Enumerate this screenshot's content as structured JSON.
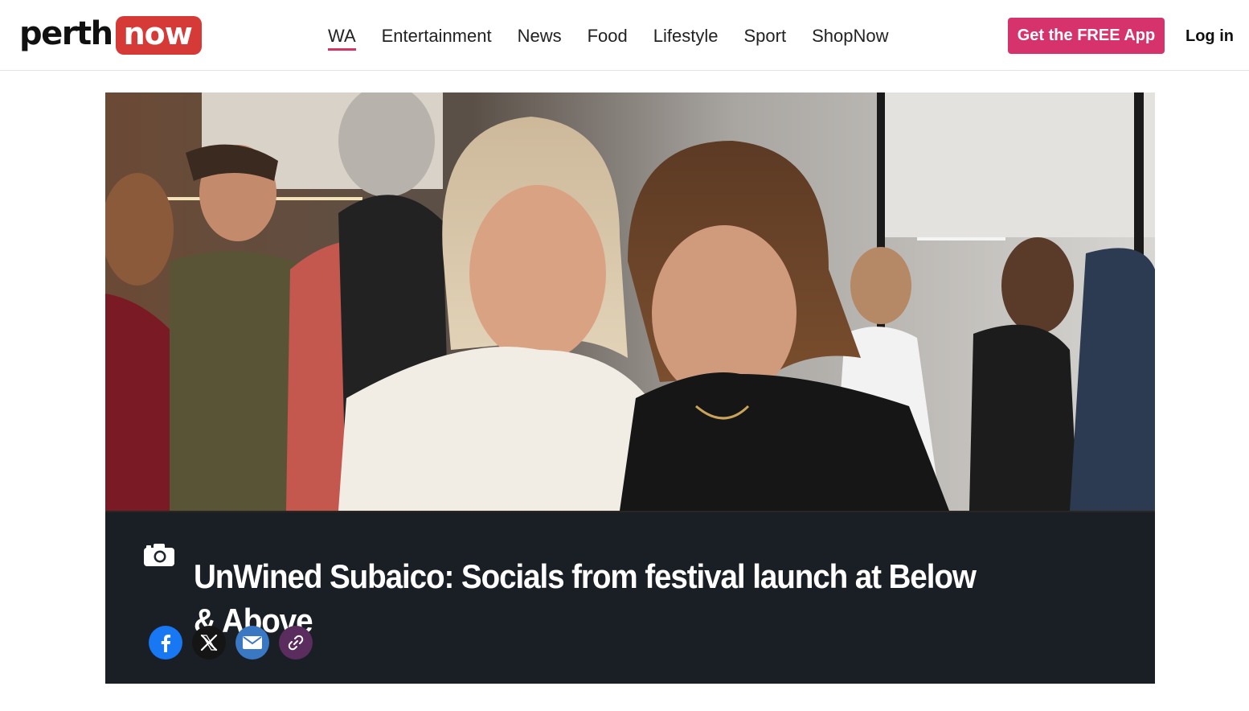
{
  "logo": {
    "part1": "perth",
    "part2": "now"
  },
  "nav": {
    "items": [
      "WA",
      "Entertainment",
      "News",
      "Food",
      "Lifestyle",
      "Sport",
      "ShopNow"
    ],
    "active_index": 0
  },
  "header": {
    "app_button": "Get the FREE App",
    "login": "Log in"
  },
  "hero": {
    "headline": "UnWined Subaico: Socials from festival launch at Below & Above",
    "icon": "camera-icon"
  },
  "share": {
    "icons": [
      "facebook-icon",
      "x-icon",
      "email-icon",
      "link-icon"
    ]
  },
  "colors": {
    "brand_red": "#d63a36",
    "accent_pink": "#d6336c",
    "caption_bg": "#181e26"
  }
}
